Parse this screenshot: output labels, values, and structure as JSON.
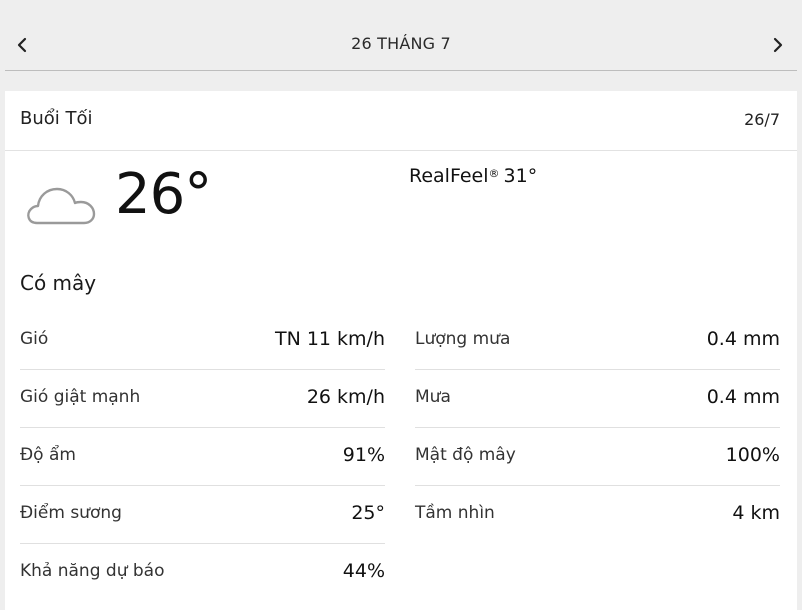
{
  "nav": {
    "title": "26 THÁNG 7"
  },
  "card": {
    "period": "Buổi Tối",
    "date": "26/7",
    "temperature": "26°",
    "realfeel_label": "RealFeel",
    "realfeel_mark": "®",
    "realfeel_value": "31°",
    "condition": "Có mây",
    "weather_icon": "cloud-icon"
  },
  "details_left": [
    {
      "label": "Gió",
      "value": "TN 11 km/h"
    },
    {
      "label": "Gió giật mạnh",
      "value": "26 km/h"
    },
    {
      "label": "Độ ẩm",
      "value": "91%"
    },
    {
      "label": "Điểm sương",
      "value": "25°"
    },
    {
      "label": "Khả năng dự báo",
      "value": "44%"
    }
  ],
  "details_right": [
    {
      "label": "Lượng mưa",
      "value": "0.4 mm"
    },
    {
      "label": "Mưa",
      "value": "0.4 mm"
    },
    {
      "label": "Mật độ mây",
      "value": "100%"
    },
    {
      "label": "Tầm nhìn",
      "value": "4 km"
    }
  ],
  "colors": {
    "background": "#eeeeee",
    "card": "#ffffff",
    "divider": "#e0e0e0",
    "text": "#1a1a1a"
  }
}
